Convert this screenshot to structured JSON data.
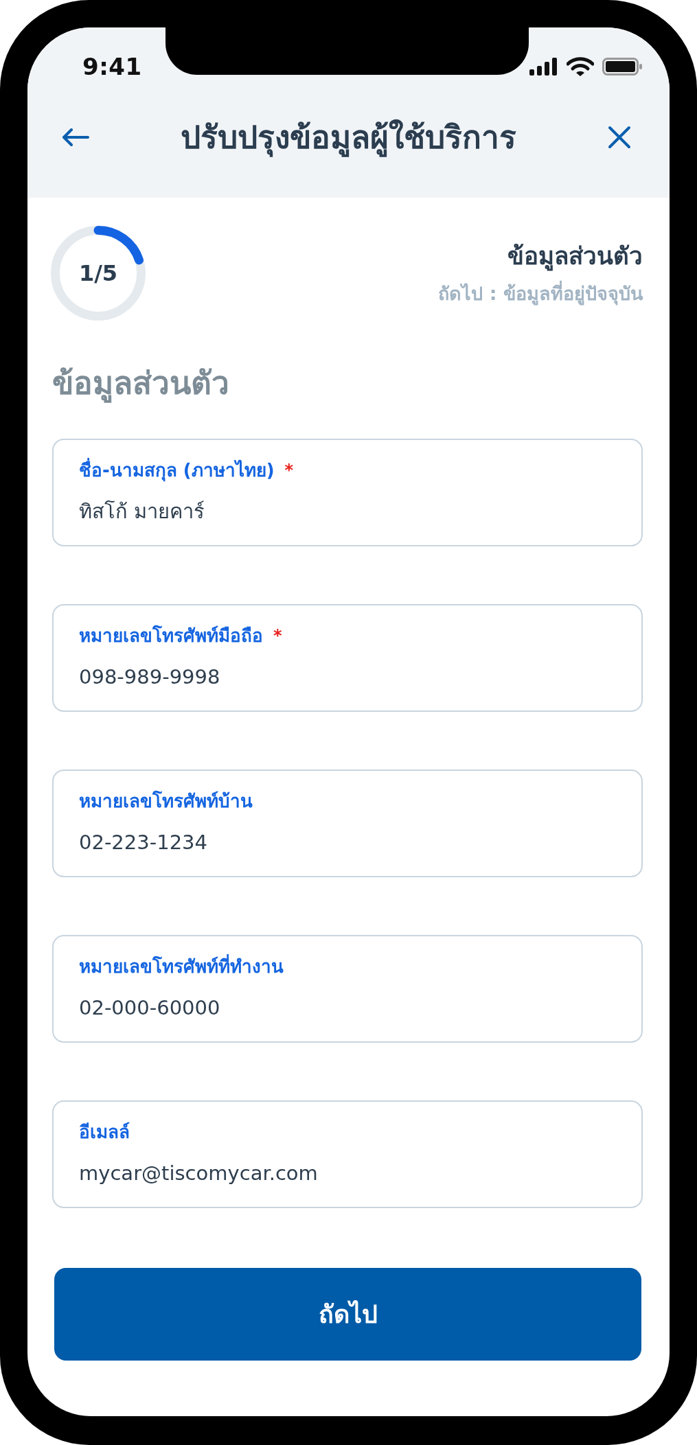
{
  "status_bar": {
    "time": "9:41"
  },
  "header": {
    "title": "ปรับปรุงข้อมูลผู้ใช้บริการ"
  },
  "progress": {
    "step": "1/5",
    "level": 0.2,
    "title": "ข้อมูลส่วนตัว",
    "next": "ถัดไป : ข้อมูลที่อยู่ปัจจุบัน"
  },
  "section_title": "ข้อมูลส่วนตัว",
  "fields": [
    {
      "label": "ชื่อ-นามสกุล (ภาษาไทย)",
      "required_mark": "*",
      "value": "ทิสโก้ มายคาร์"
    },
    {
      "label": "หมายเลขโทรศัพท์มือถือ",
      "required_mark": "*",
      "value": "098-989-9998"
    },
    {
      "label": "หมายเลขโทรศัพท์บ้าน",
      "value": "02-223-1234"
    },
    {
      "label": "หมายเลขโทรศัพท์ที่ทำงาน",
      "value": "02-000-60000"
    },
    {
      "label": "อีเมลล์",
      "value": "mycar@tiscomycar.com"
    }
  ],
  "button": {
    "label": "ถัดไป"
  }
}
